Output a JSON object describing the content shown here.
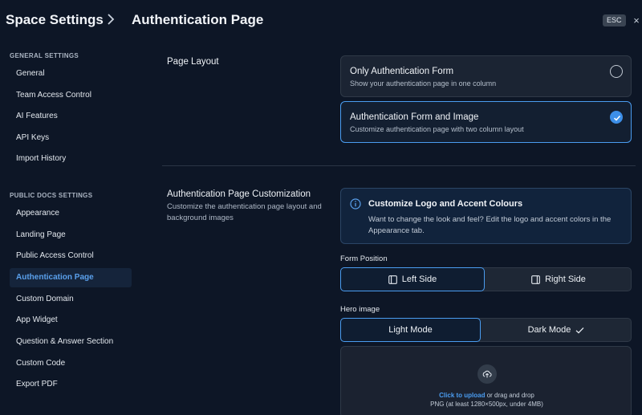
{
  "header": {
    "breadcrumb_root": "Space Settings",
    "page_title": "Authentication Page",
    "esc_label": "ESC",
    "close_glyph": "×"
  },
  "sidebar": {
    "general_title": "GENERAL SETTINGS",
    "general_items": [
      "General",
      "Team Access Control",
      "AI Features",
      "API Keys",
      "Import History"
    ],
    "public_title": "PUBLIC DOCS SETTINGS",
    "public_items": [
      "Appearance",
      "Landing Page",
      "Public Access Control",
      "Authentication Page",
      "Custom Domain",
      "App Widget",
      "Question & Answer Section",
      "Custom Code",
      "Export PDF"
    ],
    "active_item": "Authentication Page"
  },
  "page_layout": {
    "title": "Page Layout",
    "options": [
      {
        "title": "Only Authentication Form",
        "desc": "Show your authentication page in one column",
        "selected": false
      },
      {
        "title": "Authentication Form and Image",
        "desc": "Customize authentication page with two column layout",
        "selected": true
      }
    ]
  },
  "customization": {
    "title": "Authentication Page Customization",
    "desc": "Customize the authentication page layout and background images",
    "info_title": "Customize Logo and Accent Colours",
    "info_text": "Want to change the look and feel? Edit the logo and accent colors in the Appearance tab.",
    "form_position_label": "Form Position",
    "form_position_options": [
      "Left Side",
      "Right Side"
    ],
    "form_position_selected": "Left Side",
    "hero_label": "Hero image",
    "hero_options": [
      "Light Mode",
      "Dark Mode"
    ],
    "hero_selected": "Light Mode",
    "upload_link": "Click to upload",
    "upload_rest": " or drag and drop",
    "upload_hint": "PNG (at least 1280×500px, under 4MB)"
  },
  "colors": {
    "background": "#0d1626",
    "accent": "#4a9cf0",
    "active_nav_bg": "#15243b"
  },
  "icons": {
    "breadcrumb_separator": "chevron-right-icon",
    "radio_checked": "check-icon",
    "info": "info-icon",
    "left_side": "panel-left-icon",
    "right_side": "panel-right-icon",
    "dark_mode": "check-icon",
    "upload": "cloud-upload-icon"
  }
}
